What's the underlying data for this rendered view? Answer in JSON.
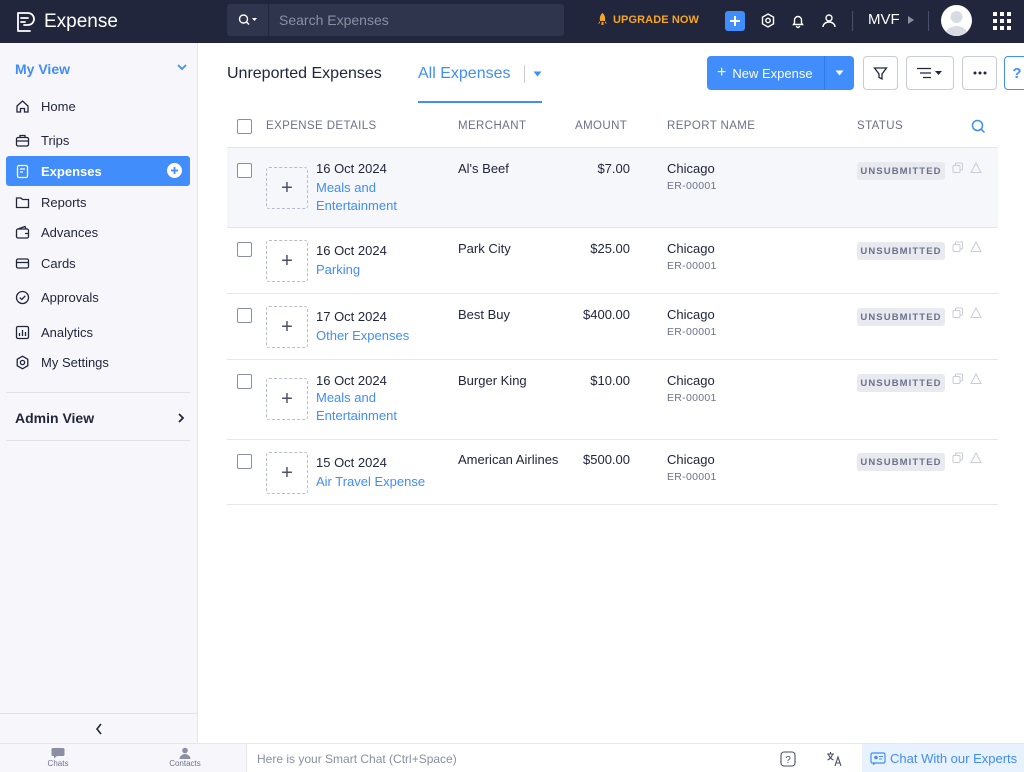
{
  "app": {
    "name": "Expense"
  },
  "search": {
    "placeholder": "Search Expenses"
  },
  "topbar": {
    "upgrade_label": "UPGRADE NOW",
    "org_name": "MVF"
  },
  "sidebar": {
    "my_view_label": "My View",
    "items": [
      {
        "label": "Home",
        "icon": "home-icon"
      },
      {
        "label": "Trips",
        "icon": "suitcase-icon"
      },
      {
        "label": "Expenses",
        "icon": "receipt-icon",
        "active": true
      },
      {
        "label": "Reports",
        "icon": "folder-icon"
      },
      {
        "label": "Advances",
        "icon": "wallet-icon"
      },
      {
        "label": "Cards",
        "icon": "card-icon"
      },
      {
        "label": "Approvals",
        "icon": "check-circle-icon"
      },
      {
        "label": "Analytics",
        "icon": "chart-icon"
      },
      {
        "label": "My Settings",
        "icon": "gear-icon"
      }
    ],
    "admin_view_label": "Admin View"
  },
  "tabs": {
    "unreported": "Unreported Expenses",
    "all": "All Expenses"
  },
  "toolbar": {
    "new_expense_label": "New Expense",
    "help_label": "?"
  },
  "table": {
    "columns": [
      "EXPENSE DETAILS",
      "MERCHANT",
      "AMOUNT",
      "REPORT NAME",
      "STATUS"
    ],
    "rows": [
      {
        "date": "16 Oct 2024",
        "category": "Meals and Entertainment",
        "merchant": "Al's Beef",
        "amount": "$7.00",
        "report_name": "Chicago",
        "report_id": "ER-00001",
        "status": "UNSUBMITTED"
      },
      {
        "date": "16 Oct 2024",
        "category": "Parking",
        "merchant": "Park City",
        "amount": "$25.00",
        "report_name": "Chicago",
        "report_id": "ER-00001",
        "status": "UNSUBMITTED"
      },
      {
        "date": "17 Oct 2024",
        "category": "Other Expenses",
        "merchant": "Best Buy",
        "amount": "$400.00",
        "report_name": "Chicago",
        "report_id": "ER-00001",
        "status": "UNSUBMITTED"
      },
      {
        "date": "16 Oct 2024",
        "category": "Meals and Entertainment",
        "merchant": "Burger King",
        "amount": "$10.00",
        "report_name": "Chicago",
        "report_id": "ER-00001",
        "status": "UNSUBMITTED"
      },
      {
        "date": "15 Oct 2024",
        "category": "Air Travel Expense",
        "merchant": "American Airlines",
        "amount": "$500.00",
        "report_name": "Chicago",
        "report_id": "ER-00001",
        "status": "UNSUBMITTED"
      }
    ]
  },
  "bottombar": {
    "chats_label": "Chats",
    "contacts_label": "Contacts",
    "smart_chat_placeholder": "Here is your Smart Chat (Ctrl+Space)",
    "experts_label": "Chat With our Experts"
  },
  "colors": {
    "accent": "#408dfb",
    "topbar": "#21263c",
    "upgrade": "#f5a623"
  }
}
